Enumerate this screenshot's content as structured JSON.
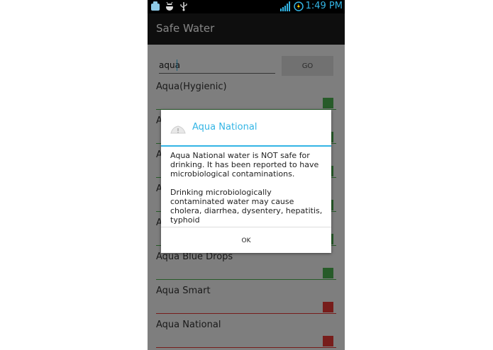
{
  "status_bar": {
    "time": "1:49 PM",
    "left_icons": [
      "app-notification-icon",
      "android-debug-icon",
      "usb-icon"
    ],
    "right_icons": [
      "signal-icon",
      "battery-icon"
    ]
  },
  "app": {
    "title": "Safe Water"
  },
  "search": {
    "value": "aqua",
    "go_label": "GO"
  },
  "results": [
    {
      "name": "Aqua(Hygienic)",
      "status": "safe",
      "color": "#4caf50"
    },
    {
      "name": "A",
      "status": "safe",
      "color": "#4caf50"
    },
    {
      "name": "A",
      "status": "safe",
      "color": "#4caf50"
    },
    {
      "name": "A",
      "status": "safe",
      "color": "#4caf50"
    },
    {
      "name": "A",
      "status": "safe",
      "color": "#4caf50"
    },
    {
      "name": "Aqua Blue Drops",
      "status": "safe",
      "color": "#4caf50"
    },
    {
      "name": "Aqua Smart",
      "status": "unsafe",
      "color": "#e53935"
    },
    {
      "name": "Aqua National",
      "status": "unsafe",
      "color": "#e53935"
    }
  ],
  "dialog": {
    "title": "Aqua National",
    "message_1": "Aqua National water is NOT safe for drinking. It has been reported to have microbiological contaminations.",
    "message_2": "Drinking microbiologically contaminated water may cause cholera, diarrhea, dysentery, hepatitis, typhoid",
    "ok_label": "OK"
  },
  "colors": {
    "accent": "#33b5e5",
    "safe": "#4caf50",
    "unsafe": "#e53935",
    "actionbar": "#1c1c1c"
  }
}
